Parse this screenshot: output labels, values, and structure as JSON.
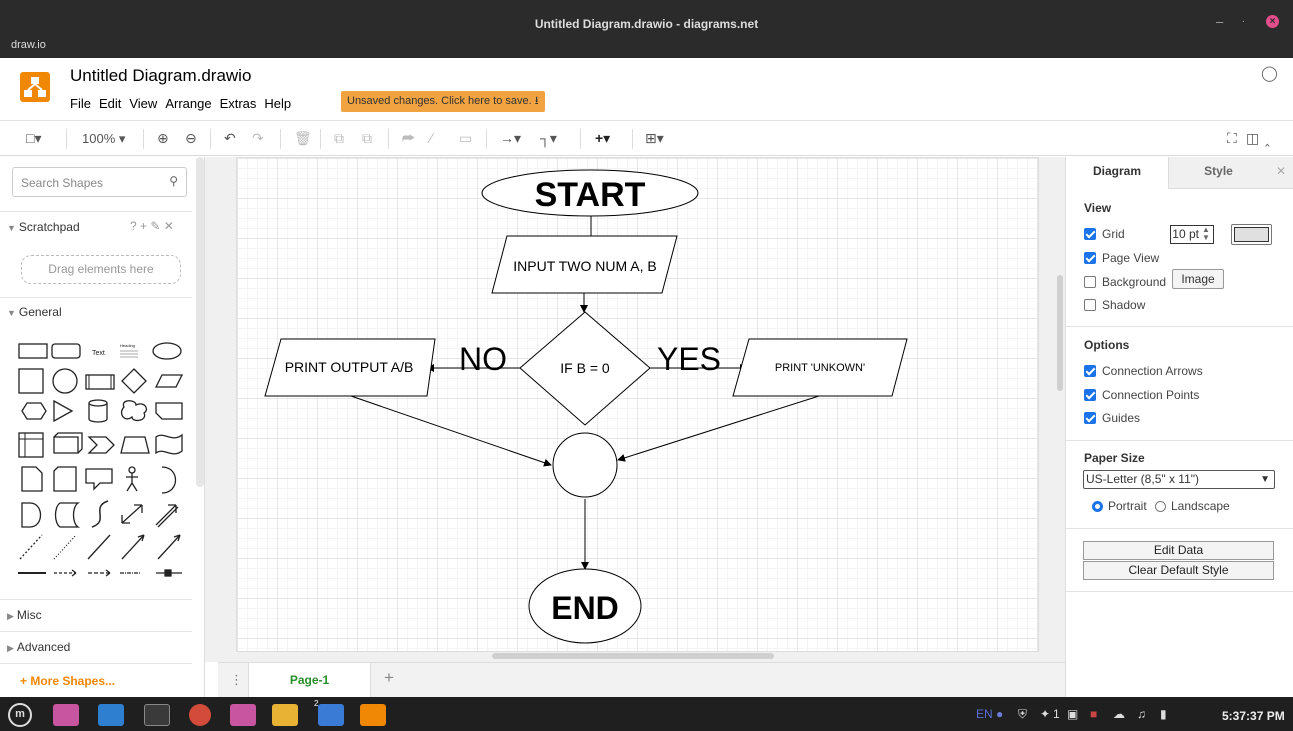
{
  "window": {
    "title": "Untitled Diagram.drawio - diagrams.net",
    "app_name": "draw.io",
    "minimize_icon": "minimize-icon",
    "restore_icon": "restore-icon",
    "close_icon": "close-icon"
  },
  "header": {
    "doc_title": "Untitled Diagram.drawio",
    "menu": [
      "File",
      "Edit",
      "View",
      "Arrange",
      "Extras",
      "Help"
    ],
    "unsaved": "Unsaved changes. Click here to save. ⭳",
    "globe_icon": "globe-icon"
  },
  "toolbar": {
    "zoom": "100% ▾",
    "format_icon": "□▾",
    "zoom_in": "⊕",
    "zoom_out": "⊖",
    "undo": "↶",
    "redo": "↷",
    "delete": "🗑",
    "to_front": "⧉",
    "to_back": "⧉",
    "fill": "⮫",
    "line": "∕",
    "shadow": "▭",
    "connection": "→▾",
    "waypoints": "┐▾",
    "insert": "+▾",
    "table": "⊞▾",
    "fullscreen": "⛶",
    "panel": "◫",
    "collapse": "‸"
  },
  "left": {
    "search_placeholder": "Search Shapes",
    "scratchpad": "Scratchpad",
    "scratch_controls": "? + ✎ ✕",
    "drag_here": "Drag elements here",
    "general": "General",
    "text_label": "Text",
    "heading_label": "Heading",
    "misc": "Misc",
    "advanced": "Advanced",
    "more_shapes": "+ More Shapes..."
  },
  "diagram": {
    "start": "START",
    "input": "INPUT TWO NUM A, B",
    "decision": "IF B = 0",
    "no": "NO",
    "yes": "YES",
    "print_left": "PRINT OUTPUT A/B",
    "print_right": "PRINT 'UNKOWN'",
    "end": "END"
  },
  "pages": {
    "tab": "Page-1",
    "add": "+",
    "menu": "⋮"
  },
  "format": {
    "tab_diagram": "Diagram",
    "tab_style": "Style",
    "tab_close": "✕",
    "view": "View",
    "grid": "Grid",
    "grid_size": "10 pt",
    "page_view": "Page View",
    "background": "Background",
    "image_btn": "Image",
    "shadow": "Shadow",
    "options": "Options",
    "connection_arrows": "Connection Arrows",
    "connection_points": "Connection Points",
    "guides": "Guides",
    "paper_size": "Paper Size",
    "paper_value": "US-Letter (8,5\" x 11\")",
    "portrait": "Portrait",
    "landscape": "Landscape",
    "edit_data": "Edit Data",
    "clear_style": "Clear Default Style"
  },
  "taskbar": {
    "lang": "EN",
    "workspace": "1",
    "badge": "2",
    "clock": "5:37:37 PM"
  },
  "colors": {
    "accent": "#1a73e8",
    "drawio_orange": "#f08705",
    "unsaved_bg": "#f2a341",
    "page_tab_text": "#2a8f2a"
  }
}
